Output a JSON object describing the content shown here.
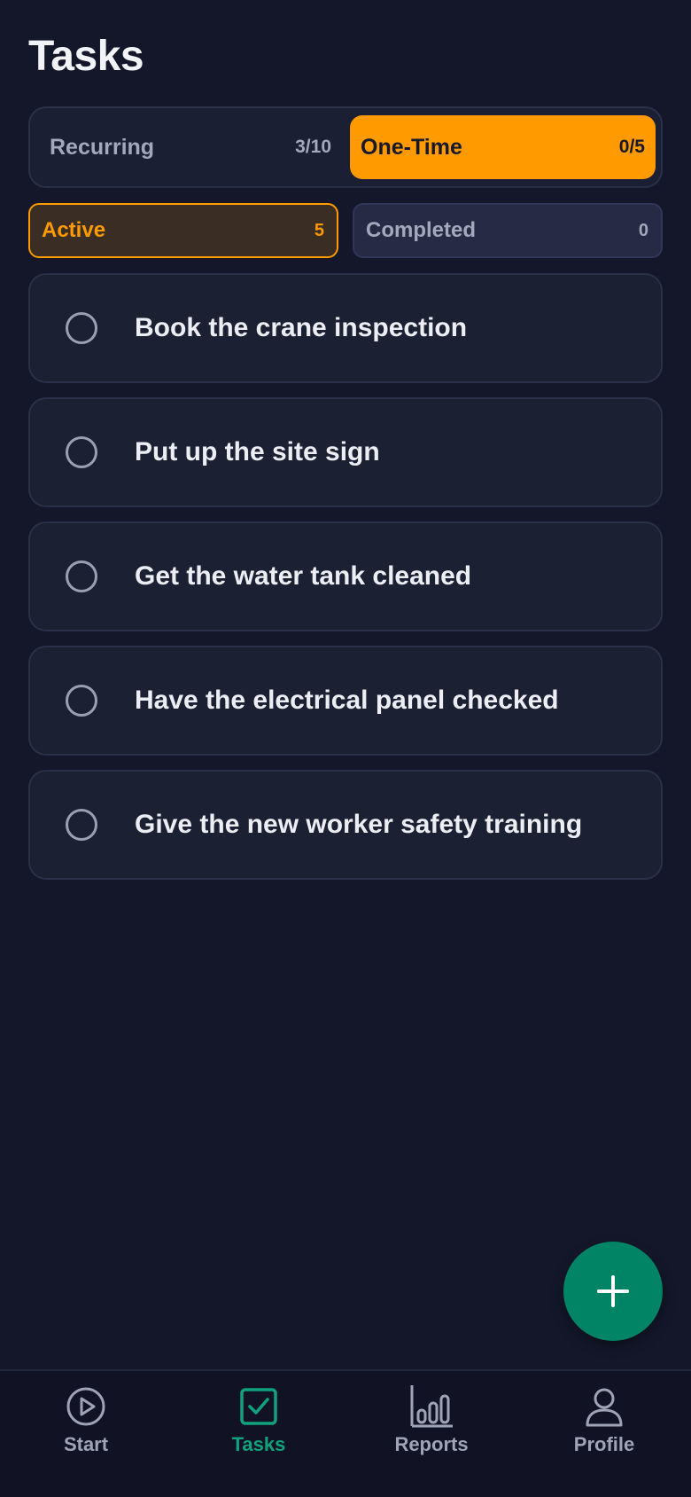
{
  "page": {
    "title": "Tasks"
  },
  "type_switch": {
    "recurring_label": "Recurring",
    "recurring_count": "3/10",
    "onetime_label": "One-Time",
    "onetime_count": "0/5",
    "selected": "One-Time"
  },
  "status_filter": {
    "active_label": "Active",
    "active_count": "5",
    "completed_label": "Completed",
    "completed_count": "0",
    "selected": "Active"
  },
  "tasks": [
    {
      "text": "Book the crane inspection",
      "done": false
    },
    {
      "text": "Put up the site sign",
      "done": false
    },
    {
      "text": "Get the water tank cleaned",
      "done": false
    },
    {
      "text": "Have the electrical panel checked",
      "done": false
    },
    {
      "text": "Give the new worker safety training",
      "done": false
    }
  ],
  "fab": {
    "icon": "plus-icon"
  },
  "bottom_nav": {
    "items": [
      {
        "label": "Start",
        "icon": "play-circle-icon"
      },
      {
        "label": "Tasks",
        "icon": "checkbox-icon"
      },
      {
        "label": "Reports",
        "icon": "bar-chart-icon"
      },
      {
        "label": "Profile",
        "icon": "person-icon"
      }
    ],
    "selected": "Tasks"
  },
  "colors": {
    "background": "#14172a",
    "accent_orange": "#ff9a00",
    "accent_green": "#008466",
    "nav_selected": "#0fa27d"
  }
}
